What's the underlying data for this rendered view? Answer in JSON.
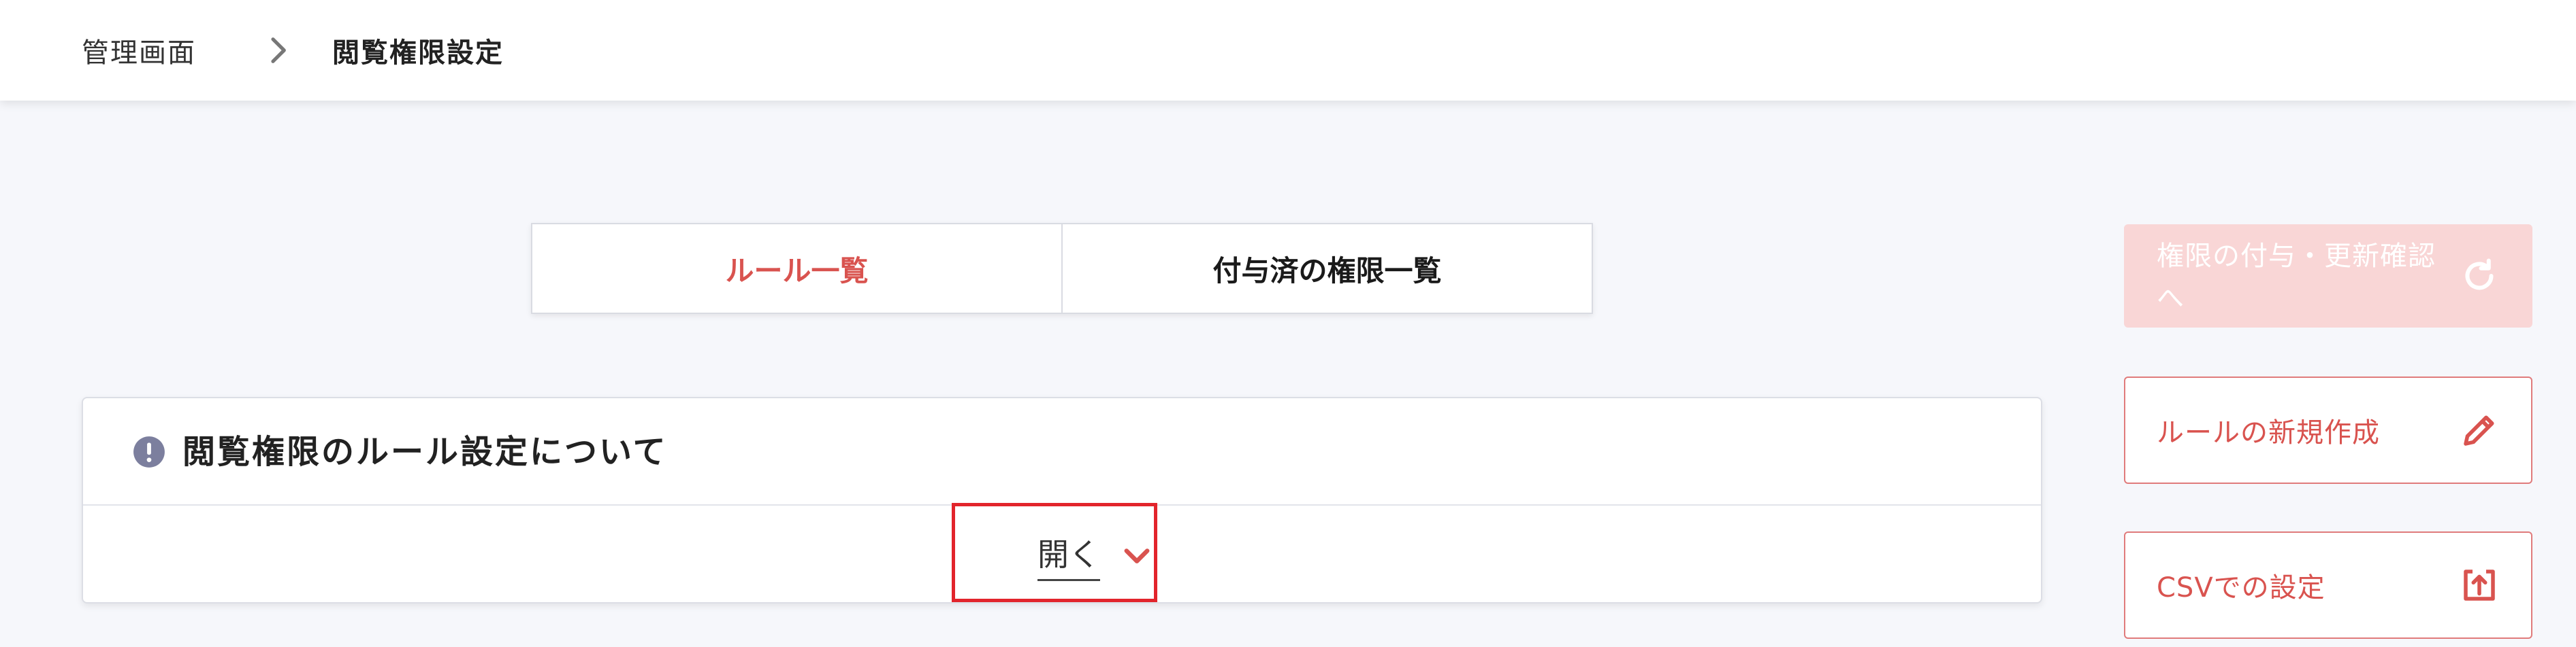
{
  "breadcrumb": {
    "root": "管理画面",
    "current": "閲覧権限設定"
  },
  "tabs": [
    {
      "label": "ルール一覧",
      "active": true
    },
    {
      "label": "付与済の権限一覧",
      "active": false
    }
  ],
  "info_panel": {
    "title": "閲覧権限のルール設定について",
    "toggle_label": "開く"
  },
  "actions": {
    "grant_update": "権限の付与・更新確認へ",
    "new_rule": "ルールの新規作成",
    "csv_settings": "CSVでの設定"
  },
  "colors": {
    "accent": "#d9534f",
    "accent_disabled": "#f9d6d6",
    "highlight": "#e2242b",
    "info_icon": "#7c7f9e"
  },
  "icons": {
    "breadcrumb_separator": "chevron-right-icon",
    "info": "exclamation-circle-icon",
    "toggle": "chevron-down-icon",
    "grant_update": "refresh-icon",
    "new_rule": "pencil-icon",
    "csv_settings": "upload-icon"
  }
}
